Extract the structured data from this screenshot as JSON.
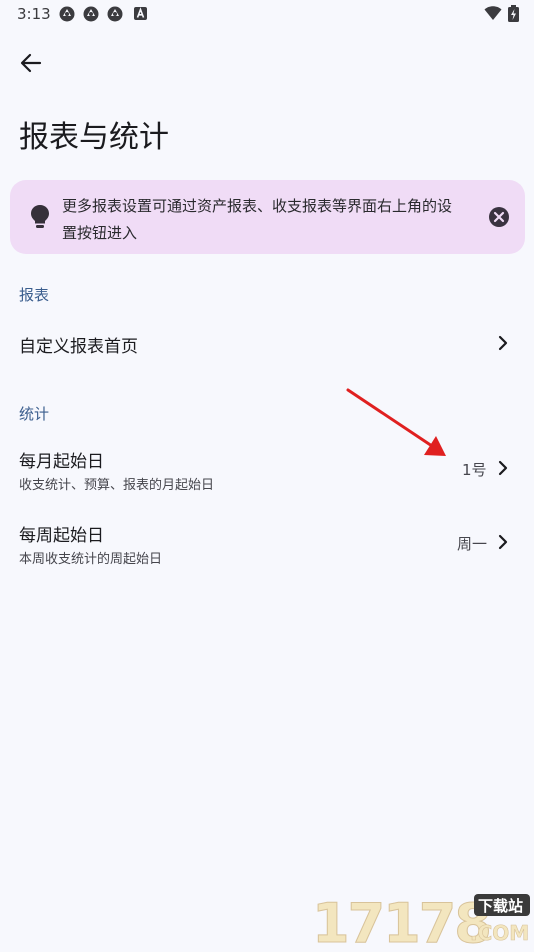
{
  "status_bar": {
    "time": "3:13",
    "left_icons": [
      "app-notification-icon",
      "app-notification-icon",
      "app-notification-icon",
      "a-badge-icon"
    ],
    "right_icons": [
      "wifi-icon",
      "battery-icon"
    ]
  },
  "header": {
    "back_icon": "arrow-left-icon",
    "title": "报表与统计"
  },
  "tip": {
    "icon": "lightbulb-icon",
    "text": "更多报表设置可通过资产报表、收支报表等界面右上角的设置按钮进入",
    "close_icon": "close-circle-icon"
  },
  "sections": {
    "reports": {
      "header": "报表",
      "items": [
        {
          "title": "自定义报表首页"
        }
      ]
    },
    "statistics": {
      "header": "统计",
      "items": [
        {
          "title": "每月起始日",
          "subtitle": "收支统计、预算、报表的月起始日",
          "value": "1号"
        },
        {
          "title": "每周起始日",
          "subtitle": "本周收支统计的周起始日",
          "value": "周一"
        }
      ]
    }
  },
  "annotation": {
    "color": "#e02020"
  },
  "watermark": {
    "brand": "17178",
    "tag": "下载站",
    "domain": ".COM"
  },
  "colors": {
    "background": "#f7f8fd",
    "tip_background": "#f0dcf6",
    "section_header": "#3b5e8e"
  }
}
